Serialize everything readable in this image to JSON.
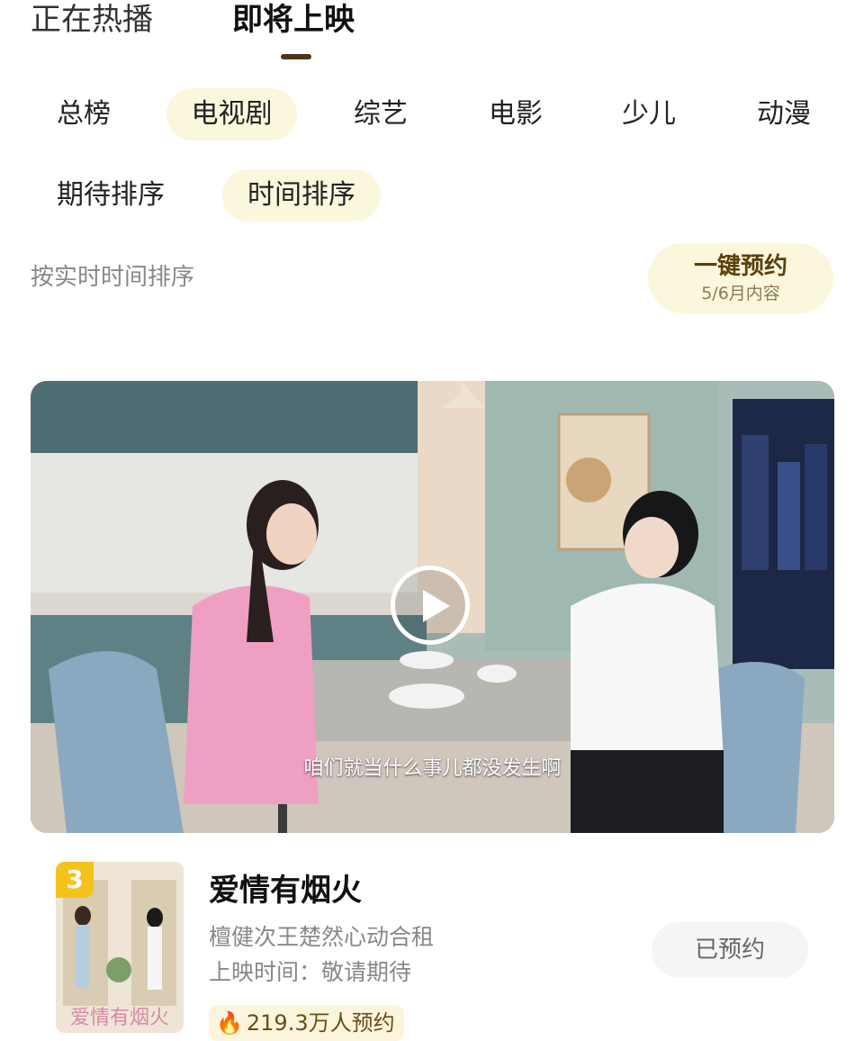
{
  "top_tabs": [
    {
      "label": "正在热播",
      "active": false
    },
    {
      "label": "即将上映",
      "active": true
    }
  ],
  "categories": [
    {
      "label": "总榜",
      "active": false
    },
    {
      "label": "电视剧",
      "active": true
    },
    {
      "label": "综艺",
      "active": false
    },
    {
      "label": "电影",
      "active": false
    },
    {
      "label": "少儿",
      "active": false
    },
    {
      "label": "动漫",
      "active": false
    }
  ],
  "sort_options": [
    {
      "label": "期待排序",
      "active": false
    },
    {
      "label": "时间排序",
      "active": true
    }
  ],
  "sort_hint": "按实时时间排序",
  "reserve_all": {
    "title": "一键预约",
    "subtitle": "5/6月内容"
  },
  "video": {
    "subtitle": "咱们就当什么事儿都没发生啊"
  },
  "show": {
    "rank": "3",
    "title": "爱情有烟火",
    "description": "檀健次王楚然心动合租",
    "release": "上映时间：敬请期待",
    "reservations": "219.3万人预约",
    "reserved_label": "已预约",
    "poster_text": "爱情有烟火"
  },
  "colors": {
    "accent_bg": "#fbf7dd",
    "accent_text": "#5b3f0c",
    "rank_badge": "#f5c21a",
    "flame": "#f29a1c"
  }
}
